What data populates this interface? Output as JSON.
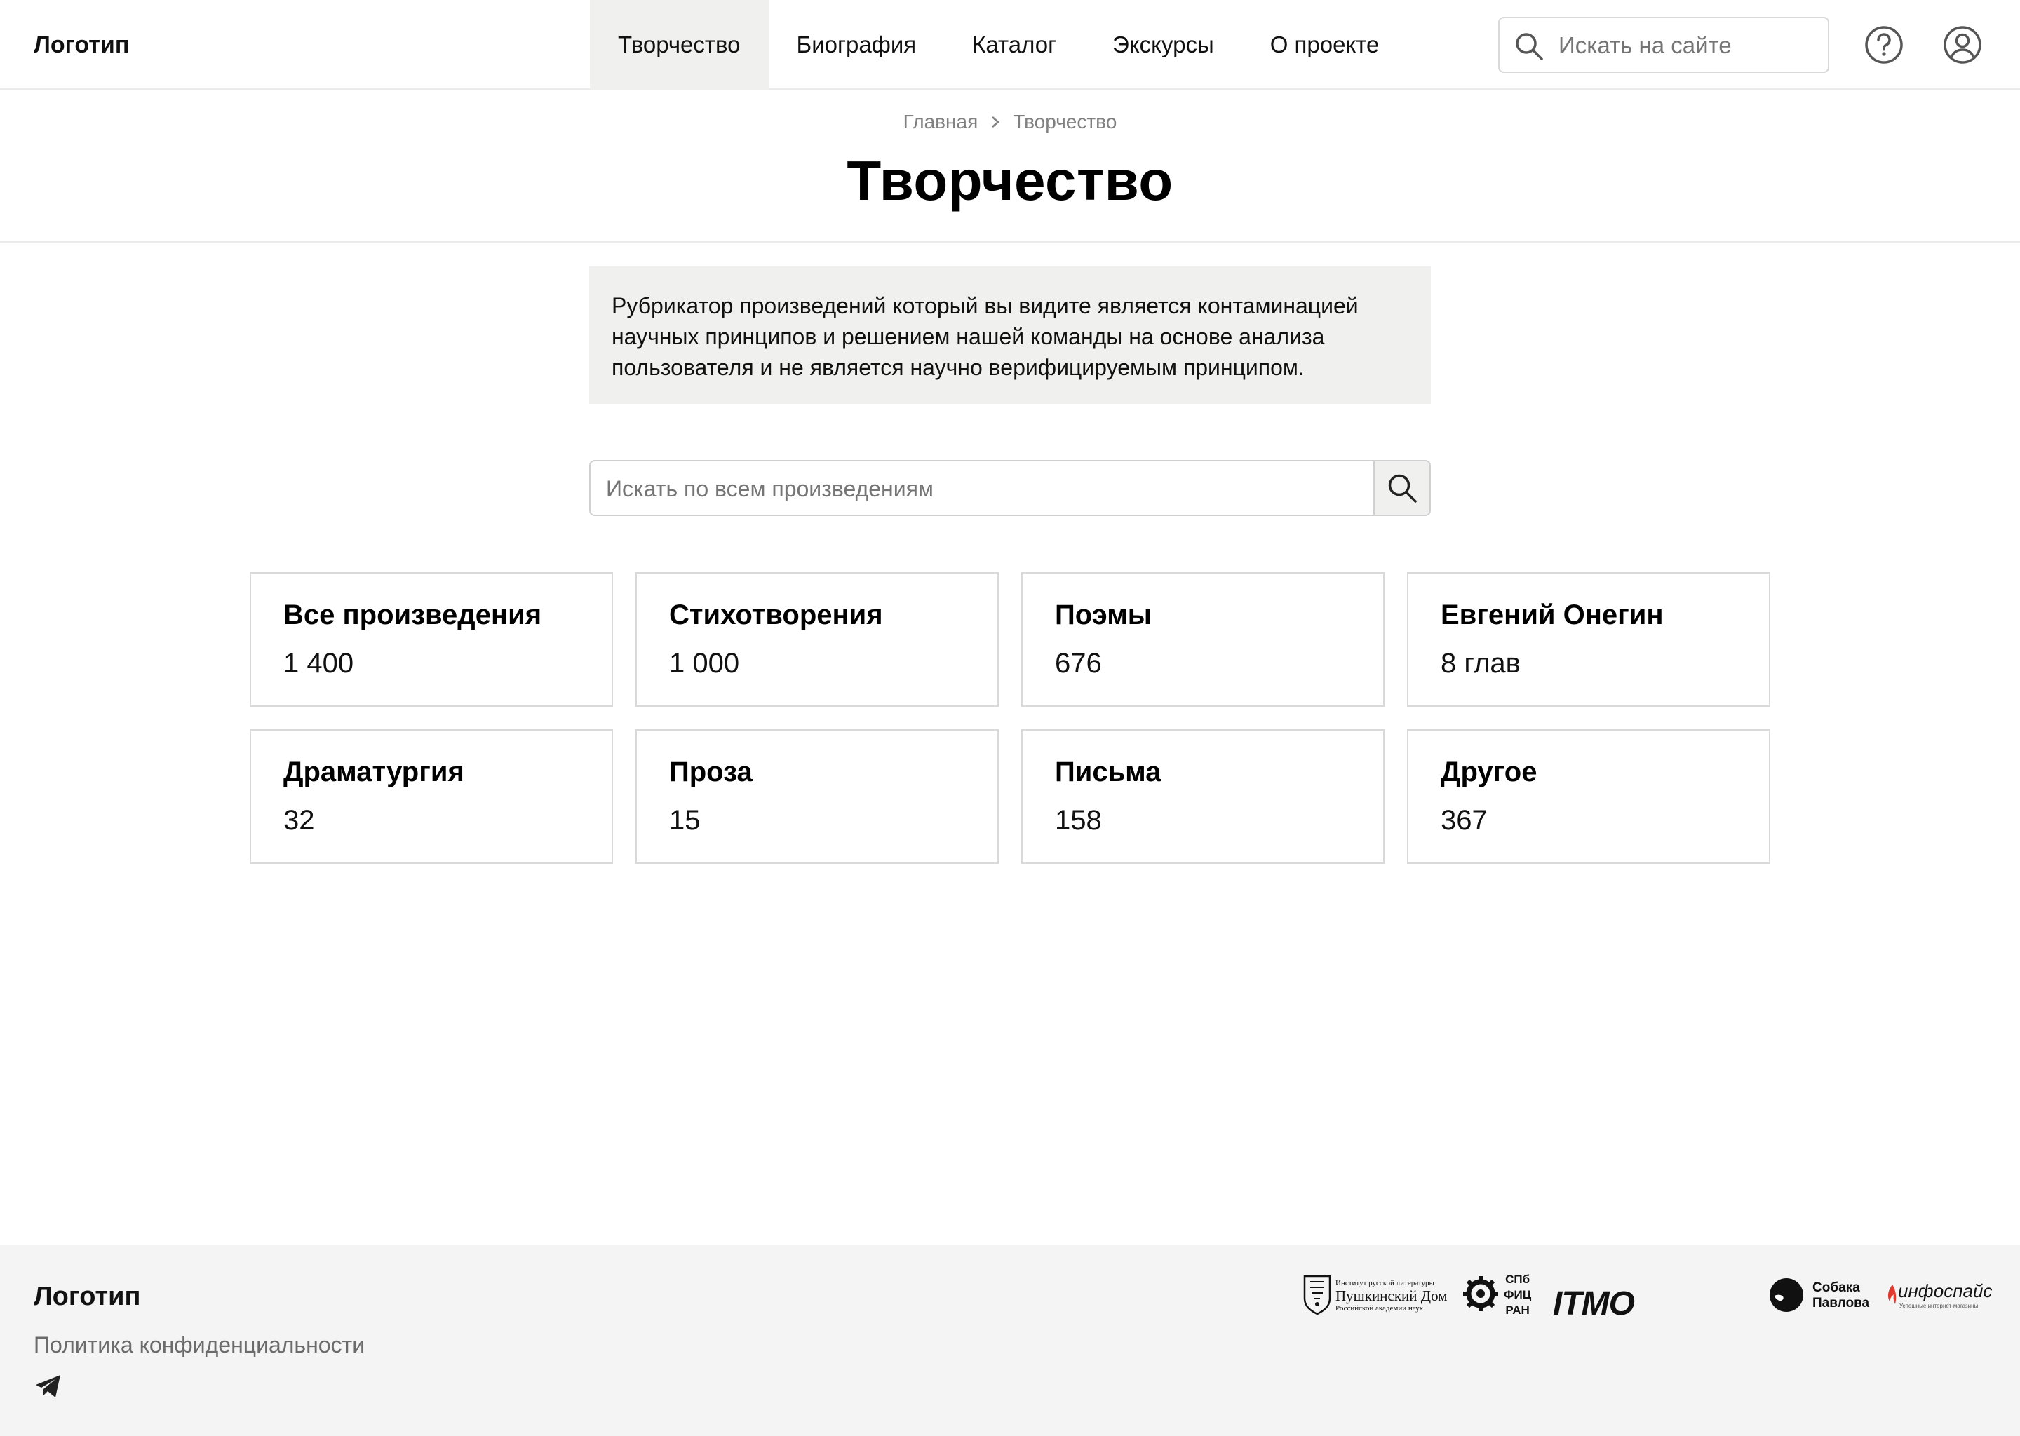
{
  "header": {
    "logo": "Логотип",
    "nav": [
      {
        "label": "Творчество",
        "active": true
      },
      {
        "label": "Биография",
        "active": false
      },
      {
        "label": "Каталог",
        "active": false
      },
      {
        "label": "Экскурсы",
        "active": false
      },
      {
        "label": "О проекте",
        "active": false
      }
    ],
    "search_placeholder": "Искать на сайте",
    "icons": [
      "search-icon",
      "help-icon",
      "user-icon"
    ]
  },
  "breadcrumb": {
    "home": "Главная",
    "separator_icon": "chevron-right-icon",
    "current": "Творчество"
  },
  "page_title": "Творчество",
  "notice": {
    "lines": [
      "Рубрикатор произведений который вы видите является контаминацией",
      "научных принципов и решением нашей команды на основе анализа",
      "пользователя и не является научно верифицируемым принципом."
    ]
  },
  "works_search": {
    "placeholder": "Искать по всем произведениям",
    "button_icon": "search-icon"
  },
  "categories": [
    {
      "title": "Все произведения",
      "count": "1 400"
    },
    {
      "title": "Стихотворения",
      "count": "1 000"
    },
    {
      "title": "Поэмы",
      "count": "676"
    },
    {
      "title": "Евгений Онегин",
      "count": "8 глав"
    },
    {
      "title": "Драматургия",
      "count": "32"
    },
    {
      "title": "Проза",
      "count": "15"
    },
    {
      "title": "Письма",
      "count": "158"
    },
    {
      "title": "Другое",
      "count": "367"
    }
  ],
  "footer": {
    "logo": "Логотип",
    "privacy": "Политика конфиденциальности",
    "social_icon": "telegram-icon",
    "partners": {
      "pushkin_house": {
        "line1": "Институт русской литературы",
        "line2": "Пушкинский Дом",
        "line3": "Российской академии наук"
      },
      "spb_fic_ran": [
        "СПб",
        "ФИЦ",
        "РАН"
      ],
      "itmo": "ITMO",
      "sobaka_pavlova": [
        "Собака",
        "Павлова"
      ],
      "infospice": {
        "name": "инфоспайс",
        "tagline": "Успешные интернет-магазины"
      }
    }
  },
  "colors": {
    "accent_bg": "#f0f0ee",
    "border": "#d9d9d9",
    "footer_bg": "#f4f4f4",
    "muted_text": "#808080"
  }
}
